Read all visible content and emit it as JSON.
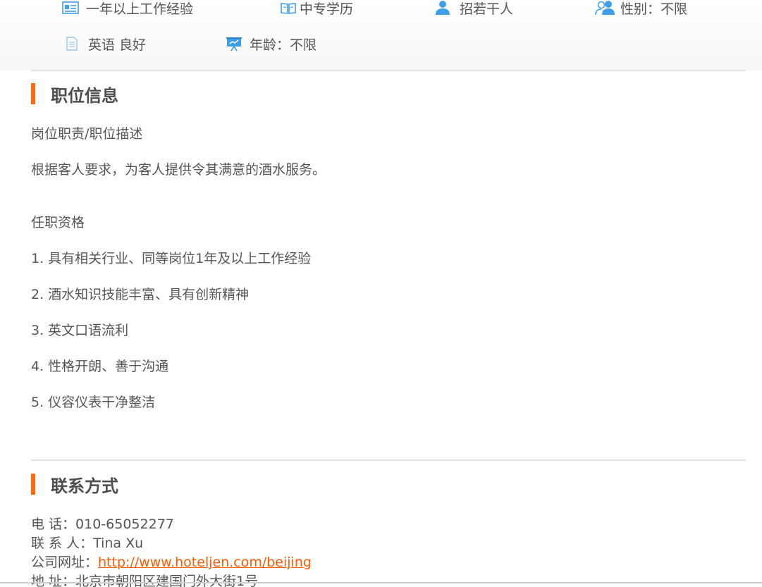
{
  "attributes": {
    "experience": "一年以上工作经验",
    "education": "中专学历",
    "headcount": "招若干人",
    "gender": "性别：不限",
    "english": "英语 良好",
    "age": "年龄：不限"
  },
  "job_info": {
    "title": "职位信息",
    "duty_heading": "岗位职责/职位描述",
    "duty_text": "根据客人要求，为客人提供令其满意的酒水服务。",
    "req_heading": "任职资格",
    "requirements": [
      "1. 具有相关行业、同等岗位1年及以上工作经验",
      "2. 酒水知识技能丰富、具有创新精神",
      "3. 英文口语流利",
      "4. 性格开朗、善于沟通",
      "5. 仪容仪表干净整洁"
    ]
  },
  "contact": {
    "title": "联系方式",
    "phone_label": "电 话：",
    "phone": "010-65052277",
    "person_label": "联 系 人：",
    "person": "Tina Xu",
    "website_label": "公司网址：",
    "website": "http://www.hoteljen.com/beijing",
    "address_label": "地 址：",
    "address": "北京市朝阳区建国门外大街1号"
  },
  "colors": {
    "accent": "#ff6b0e",
    "link": "#ff5a00",
    "icon": "#3f9fe6"
  }
}
